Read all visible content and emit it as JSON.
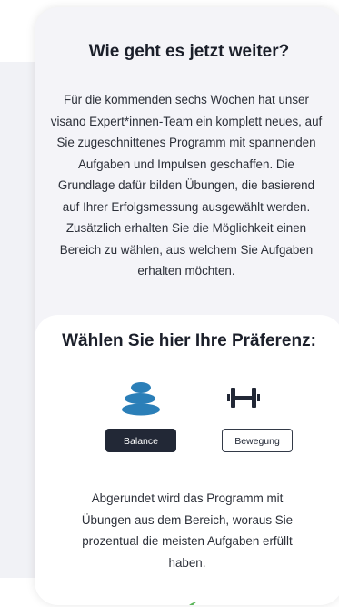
{
  "info": {
    "title": "Wie geht es jetzt weiter?",
    "text": "Für die kommenden sechs Wochen hat unser visano Expert*innen-Team ein komplett neues, auf Sie zugeschnittenes Programm mit spannenden Aufgaben und Impulsen geschaffen. Die Grundlage dafür bilden Übungen, die basierend auf Ihrer Erfolgsmessung ausgewählt werden. Zusätzlich erhalten Sie die Möglichkeit einen Bereich zu wählen, aus welchem Sie Aufgaben erhalten möchten."
  },
  "preference": {
    "title": "Wählen Sie hier Ihre Präferenz:",
    "options": [
      {
        "label": "Balance",
        "icon": "stones-icon",
        "selected": true
      },
      {
        "label": "Bewegung",
        "icon": "dumbbell-icon",
        "selected": false
      }
    ],
    "closing_text": "Abgerundet wird das Programm mit Übungen aus dem Bereich, woraus Sie prozentual die meisten Aufgaben erfüllt haben."
  },
  "colors": {
    "accent": "#2b7fb8",
    "dark": "#222836",
    "leaf": "#5bb65a"
  }
}
